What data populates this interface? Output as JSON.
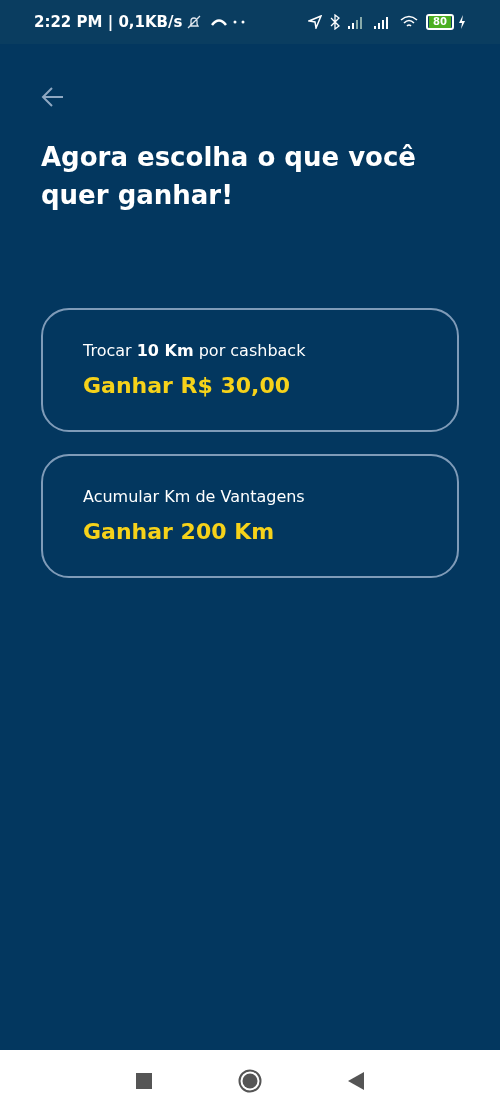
{
  "status_bar": {
    "left_text": "2:22 PM | 0,1KB/s",
    "battery": "80"
  },
  "title": "Agora escolha o que você quer ganhar!",
  "options": [
    {
      "caption": "Trocar **10 Km** por cashback",
      "reward": "Ganhar R$ 30,00"
    },
    {
      "caption": "Acumular Km de Vantagens",
      "reward": "Ganhar 200 Km"
    }
  ]
}
